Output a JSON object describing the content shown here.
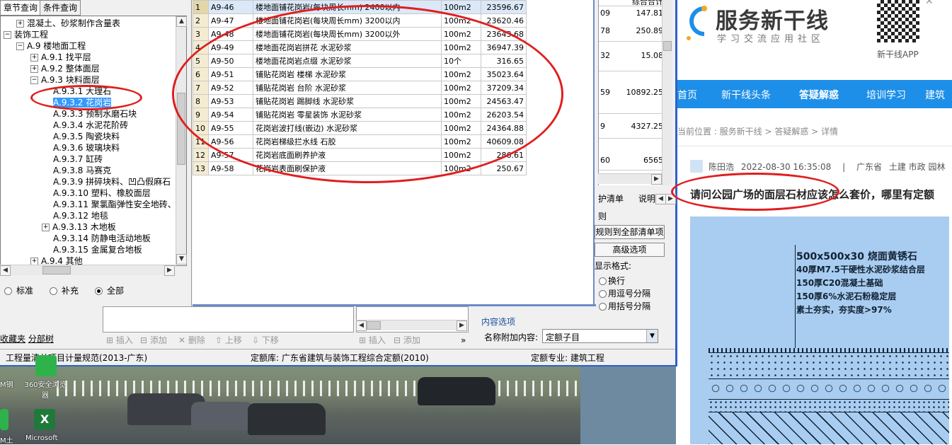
{
  "tree_pane": {
    "tabs": [
      "章节查询",
      "条件查询"
    ],
    "nodes": [
      {
        "label": "混凝土、砂浆制作含量表",
        "expander": "+"
      },
      {
        "label": "装饰工程",
        "expander": "−"
      },
      {
        "label": "A.9 楼地面工程",
        "expander": "−"
      },
      {
        "label": "A.9.1 找平层",
        "expander": "+"
      },
      {
        "label": "A.9.2 整体面层",
        "expander": "+"
      },
      {
        "label": "A.9.3 块料面层",
        "expander": "−"
      },
      {
        "label": "A.9.3.1 大理石",
        "expander": ""
      },
      {
        "label": "A.9.3.2 花岗岩",
        "expander": ""
      },
      {
        "label": "A.9.3.3 预制水磨石块",
        "expander": ""
      },
      {
        "label": "A.9.3.4 水泥花阶砖",
        "expander": ""
      },
      {
        "label": "A.9.3.5 陶瓷块料",
        "expander": ""
      },
      {
        "label": "A.9.3.6 玻璃块料",
        "expander": ""
      },
      {
        "label": "A.9.3.7 缸砖",
        "expander": ""
      },
      {
        "label": "A.9.3.8 马赛克",
        "expander": ""
      },
      {
        "label": "A.9.3.9 拼碎块料、凹凸假麻石",
        "expander": ""
      },
      {
        "label": "A.9.3.10 塑料、橡胶面层",
        "expander": ""
      },
      {
        "label": "A.9.3.11 聚氯酯弹性安全地砖、",
        "expander": ""
      },
      {
        "label": "A.9.3.12 地毯",
        "expander": ""
      },
      {
        "label": "A.9.3.13 木地板",
        "expander": "+"
      },
      {
        "label": "A.9.3.14 防静电活动地板",
        "expander": ""
      },
      {
        "label": "A.9.3.15 金属复合地板",
        "expander": ""
      },
      {
        "label": "A.9.4 其他",
        "expander": "+"
      }
    ],
    "radios": [
      "标准",
      "补充",
      "全部"
    ],
    "selected_radio": "全部",
    "bottom_tabs": [
      "收藏夹",
      "分部树"
    ]
  },
  "main_table": {
    "rows": [
      {
        "n": "1",
        "code": "A9-46",
        "name": "楼地面铺花岗岩(每块周长mm) 2400以内",
        "unit": "100m2",
        "price": "23596.67"
      },
      {
        "n": "2",
        "code": "A9-47",
        "name": "楼地面铺花岗岩(每块周长mm) 3200以内",
        "unit": "100m2",
        "price": "23620.46"
      },
      {
        "n": "3",
        "code": "A9-48",
        "name": "楼地面铺花岗岩(每块周长mm) 3200以外",
        "unit": "100m2",
        "price": "23643.68"
      },
      {
        "n": "4",
        "code": "A9-49",
        "name": "楼地面花岗岩拼花 水泥砂浆",
        "unit": "100m2",
        "price": "36947.39"
      },
      {
        "n": "5",
        "code": "A9-50",
        "name": "楼地面花岗岩点缀 水泥砂浆",
        "unit": "10个",
        "price": "316.65"
      },
      {
        "n": "6",
        "code": "A9-51",
        "name": "铺贴花岗岩 楼梯 水泥砂浆",
        "unit": "100m2",
        "price": "35023.64"
      },
      {
        "n": "7",
        "code": "A9-52",
        "name": "铺贴花岗岩 台阶 水泥砂浆",
        "unit": "100m2",
        "price": "37209.34"
      },
      {
        "n": "8",
        "code": "A9-53",
        "name": "铺贴花岗岩 踢脚线 水泥砂浆",
        "unit": "100m2",
        "price": "24563.47"
      },
      {
        "n": "9",
        "code": "A9-54",
        "name": "铺贴花岗岩 零星装饰 水泥砂浆",
        "unit": "100m2",
        "price": "26203.54"
      },
      {
        "n": "10",
        "code": "A9-55",
        "name": "花岗岩波打线(嵌边) 水泥砂浆",
        "unit": "100m2",
        "price": "24364.88"
      },
      {
        "n": "11",
        "code": "A9-56",
        "name": "花岗岩梯级拦水线 石胶",
        "unit": "100m2",
        "price": "40609.08"
      },
      {
        "n": "12",
        "code": "A9-57",
        "name": "花岗岩底面刷养护液",
        "unit": "100m2",
        "price": "286.61"
      },
      {
        "n": "13",
        "code": "A9-58",
        "name": "花岗岩表面刷保护液",
        "unit": "100m2",
        "price": "250.67"
      }
    ]
  },
  "bg_grid": {
    "header": "综合合计",
    "values": [
      "147.81",
      "250.89",
      "15.08",
      "10892.25",
      "4327.25",
      "6565"
    ],
    "left_frag": [
      "09",
      "78",
      "32",
      "59",
      "9",
      "60"
    ]
  },
  "options_panel": {
    "tab1": "护清单",
    "tab2": "说明",
    "rule_label": "则",
    "apply_all_btn": "规则到全部清单项",
    "advanced_btn": "高级选项",
    "display_format_label": "显示格式:",
    "format_options": [
      "换行",
      "用逗号分隔",
      "用括号分隔"
    ],
    "content_section": "内容选项",
    "append_label": "名称附加内容:",
    "append_value": "定额子目"
  },
  "toolbar": {
    "insert": "插入",
    "add": "添加",
    "delete": "删除",
    "up": "上移",
    "down": "下移",
    "insert2": "插入",
    "add2": "添加"
  },
  "status_bar": {
    "spec": "工程量清单项目计量规范(2013-广东)",
    "quota_lib": "定额库: 广东省建筑与装饰工程综合定额(2010)",
    "quota_major": "定额专业: 建筑工程"
  },
  "desktop": {
    "icons": [
      "M钢",
      "360安全浏览器",
      "M土",
      "Microsoft"
    ]
  },
  "site": {
    "logo_title": "服务新干线",
    "logo_sub": "学习交流应用社区",
    "app_label": "新干线APP",
    "nav": [
      "首页",
      "新干线头条",
      "答疑解惑",
      "培训学习",
      "建筑"
    ],
    "active_nav": "答疑解惑",
    "breadcrumb": "当前位置 : 服务新干线 > 答疑解惑 > 详情",
    "author": "陈田浩",
    "datetime": "2022-08-30 16:35:08",
    "location": "广东省",
    "tags": "土建 市政 园林",
    "question": "请问公园广场的面层石材应该怎么套价，哪里有定额",
    "drawing_annotations": [
      "500x500x30 烧面黄锈石",
      "40厚M7.5干硬性水泥砂浆结合层",
      "150厚C20混凝土基础",
      "150厚6%水泥石粉稳定层",
      "素土夯实，夯实度>97%"
    ]
  },
  "colors": {
    "accent_blue": "#1e8fe8",
    "highlight_red": "#e01e1e",
    "selection": "#3399ff",
    "drawing_bg": "#a9cdf1"
  }
}
